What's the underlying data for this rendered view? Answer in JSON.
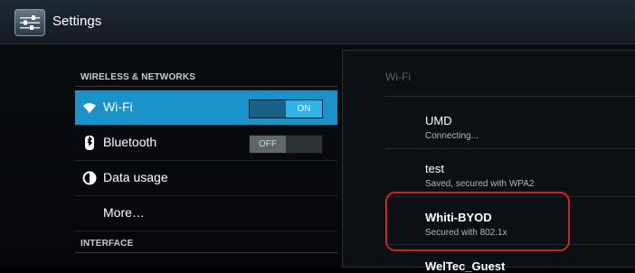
{
  "actionbar": {
    "title": "Settings",
    "icon": "settings-sliders-icon"
  },
  "sections": [
    {
      "header": "WIRELESS & NETWORKS",
      "items": [
        {
          "label": "Wi-Fi",
          "icon": "wifi-icon",
          "toggle": "ON",
          "selected": true
        },
        {
          "label": "Bluetooth",
          "icon": "bluetooth-icon",
          "toggle": "OFF"
        },
        {
          "label": "Data usage",
          "icon": "data-usage-icon"
        },
        {
          "label": "More…"
        }
      ]
    },
    {
      "header": "INTERFACE"
    }
  ],
  "wifi_panel": {
    "title": "Wi-Fi",
    "networks": [
      {
        "name": "UMD",
        "status": "Connecting..."
      },
      {
        "name": "test",
        "status": "Saved, secured with WPA2"
      },
      {
        "name": "Whiti-BYOD",
        "status": "Secured with 802.1x",
        "highlighted": true
      },
      {
        "name": "WelTec_Guest",
        "status": ""
      }
    ]
  },
  "colors": {
    "selected_bg": "#1a93c9",
    "toggle_on": "#2fb3e8",
    "highlight_border": "#d4202a"
  }
}
